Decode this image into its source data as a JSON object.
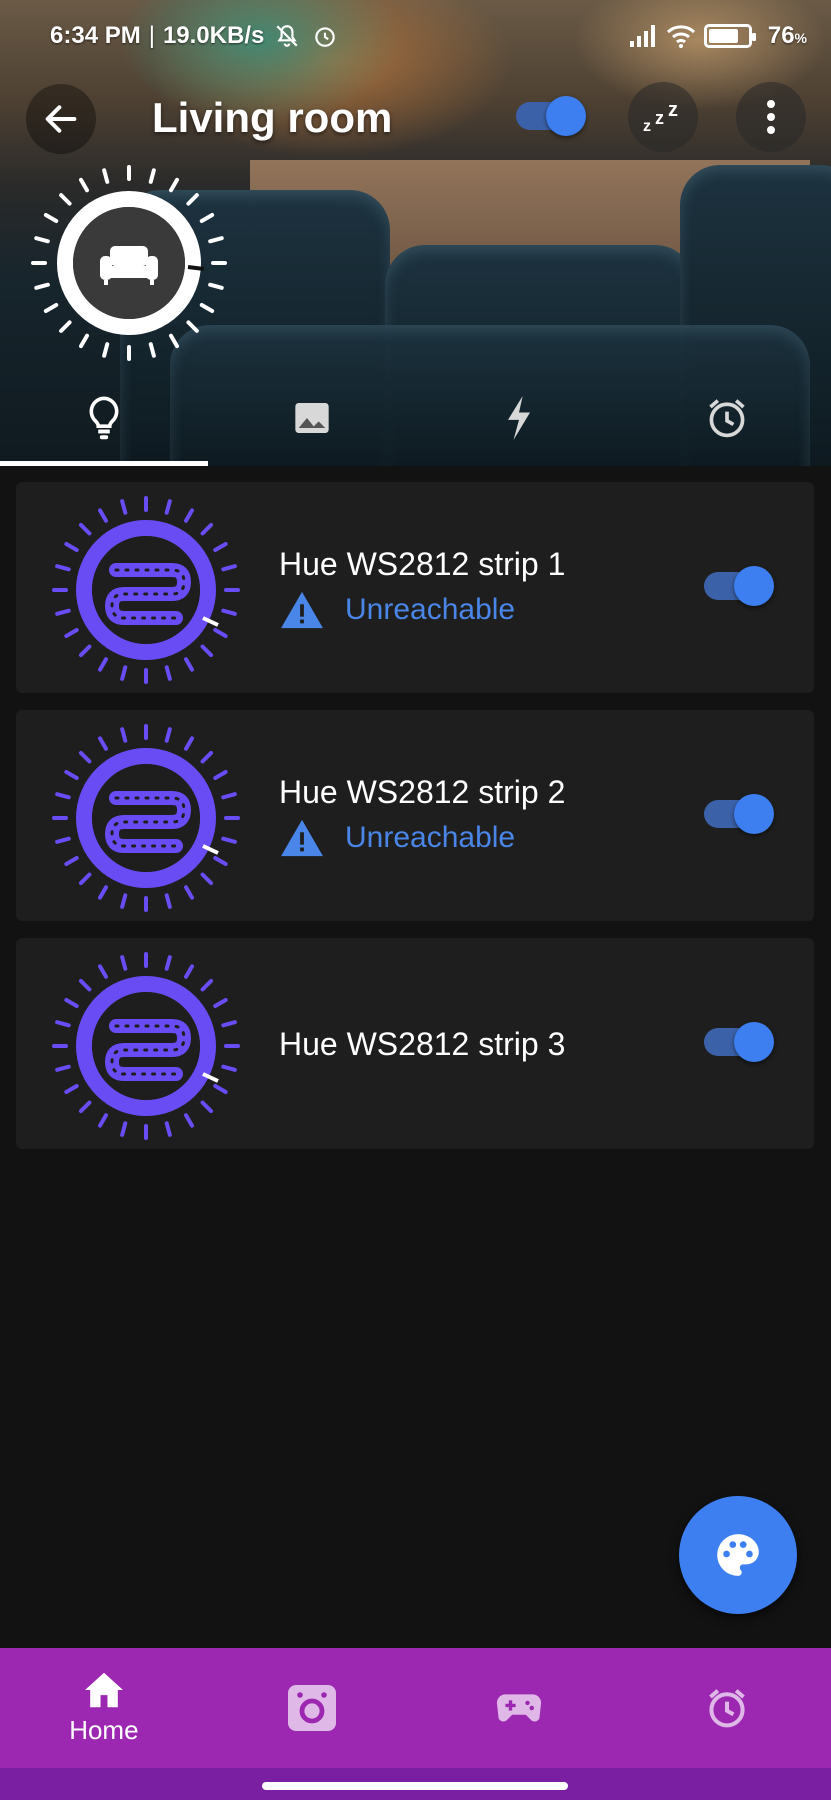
{
  "status_bar": {
    "time": "6:34 PM",
    "separator": "|",
    "speed": "19.0KB/s",
    "battery_percent": "76",
    "battery_unit": "%",
    "battery_level": 0.76,
    "icons": [
      "mute-bell-icon",
      "alarm-icon",
      "signal-icon",
      "wifi-icon",
      "battery-icon"
    ]
  },
  "header": {
    "title": "Living room",
    "room_icon": "sofa-icon",
    "group_on": true,
    "buttons": [
      "back-arrow-icon",
      "sleep-zzz-icon",
      "more-vert-icon"
    ]
  },
  "tabs": [
    {
      "icon": "lightbulb-icon",
      "active": true
    },
    {
      "icon": "image-icon",
      "active": false
    },
    {
      "icon": "flash-icon",
      "active": false
    },
    {
      "icon": "alarm-icon",
      "active": false
    }
  ],
  "lights": [
    {
      "name": "Hue WS2812 strip 1",
      "status": "Unreachable",
      "on": true,
      "icon": "light-strip-icon"
    },
    {
      "name": "Hue WS2812 strip 2",
      "status": "Unreachable",
      "on": true,
      "icon": "light-strip-icon"
    },
    {
      "name": "Hue WS2812 strip 3",
      "status": "",
      "on": true,
      "icon": "light-strip-icon"
    }
  ],
  "fab": {
    "icon": "palette-icon"
  },
  "bottom_nav": [
    {
      "label": "Home",
      "icon": "home-icon",
      "active": true
    },
    {
      "label": "",
      "icon": "camera-icon",
      "active": false
    },
    {
      "label": "",
      "icon": "gamepad-icon",
      "active": false
    },
    {
      "label": "",
      "icon": "alarm-icon",
      "active": false
    }
  ],
  "colors": {
    "accent": "#3d7ff0",
    "light_ring": "#6a4cf5",
    "warning_text": "#4a86e8",
    "nav_bg": "#9c27b0",
    "card_bg": "#1e1e1e",
    "page_bg": "#121212"
  }
}
